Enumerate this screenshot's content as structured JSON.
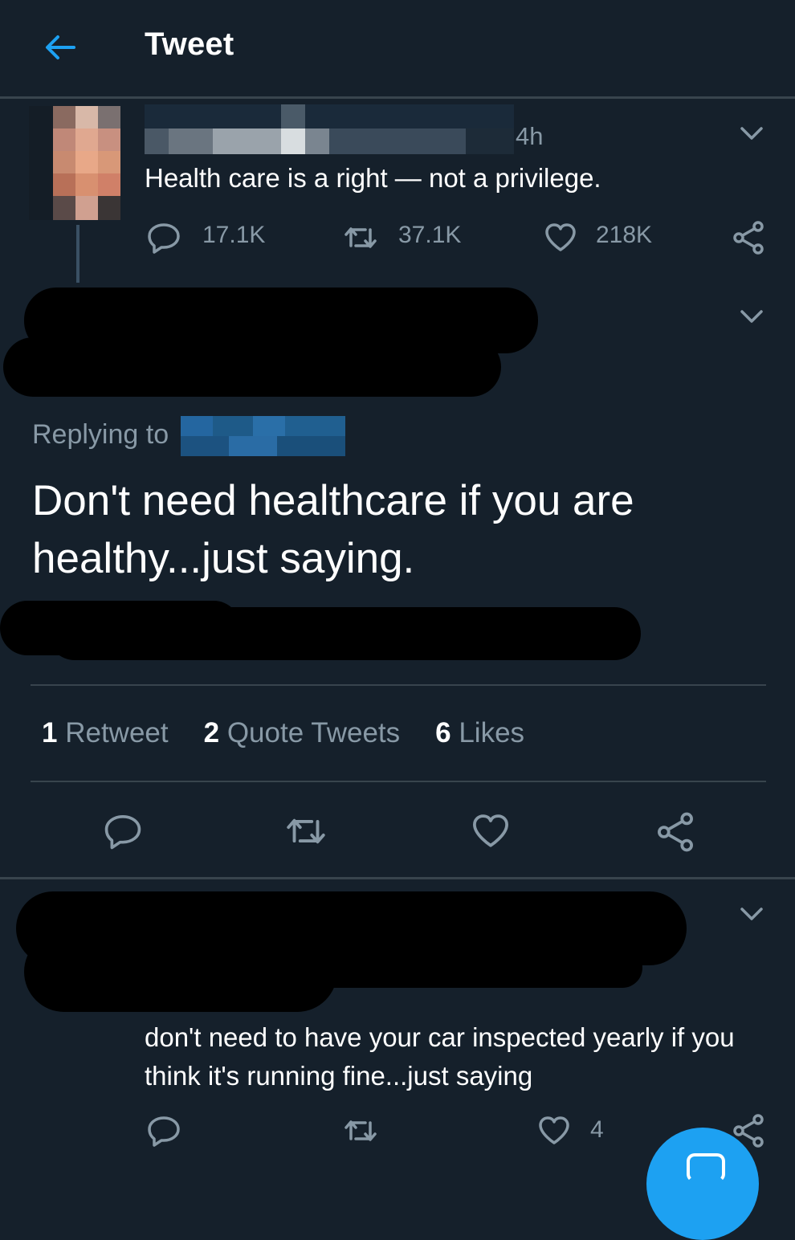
{
  "header": {
    "title": "Tweet",
    "back_icon": "arrow-left-icon",
    "accent": "#1da1f2"
  },
  "parent_tweet": {
    "time": "4h",
    "text": "Health care is a right — not a privilege.",
    "replies": "17.1K",
    "retweets": "37.1K",
    "likes": "218K"
  },
  "main_tweet": {
    "replying_label": "Replying to",
    "text": "Don't need healthcare if you are healthy...just saying.",
    "stats": {
      "retweets_count": "1",
      "retweets_label": "Retweet",
      "quotes_count": "2",
      "quotes_label": "Quote Tweets",
      "likes_count": "6",
      "likes_label": "Likes"
    }
  },
  "reply_tweet": {
    "text": "don't need to have your car inspected yearly if you think it's running fine...just saying",
    "likes": "4"
  },
  "colors": {
    "background": "#15202b",
    "muted": "#8899a6",
    "divider": "#38444d",
    "fab": "#1da1f2"
  }
}
